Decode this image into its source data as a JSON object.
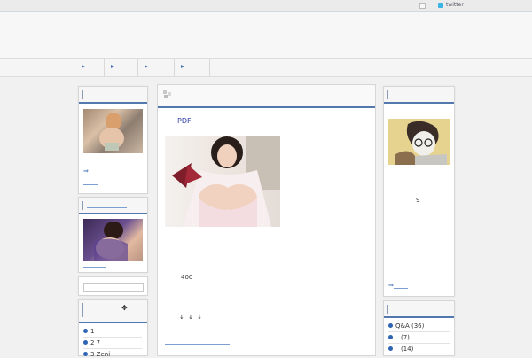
{
  "topbar": {
    "twitter_label": "twitter"
  },
  "main": {
    "pdf_link": "PDF",
    "count_text": "400",
    "arrows": "↓ ↓ ↓"
  },
  "left": {
    "box1_arrow": "⇒",
    "box4_icon": "✥",
    "list": [
      {
        "text": "1"
      },
      {
        "text": "2 7"
      },
      {
        "text": "3 Zeni"
      }
    ]
  },
  "right": {
    "number": "9",
    "arrow": "⇒",
    "categories": [
      {
        "text": "Q&A (36)"
      },
      {
        "text": "(7)"
      },
      {
        "text": "(14)"
      }
    ]
  },
  "colors": {
    "accent": "#5278ad",
    "link": "#2f63b3",
    "twitter": "#3ab4e3"
  }
}
